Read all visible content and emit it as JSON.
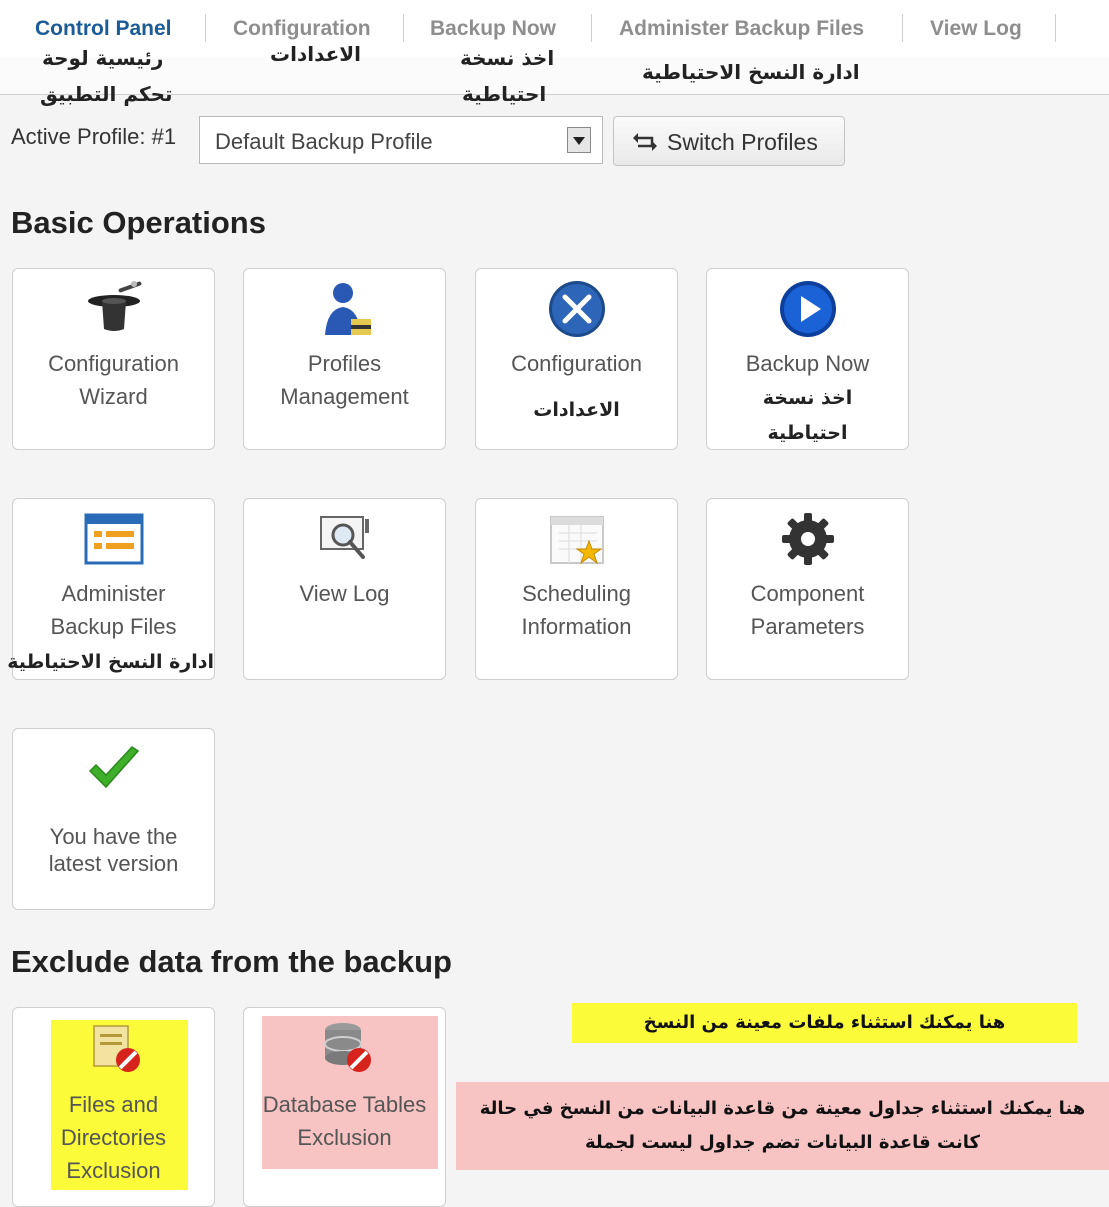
{
  "tabs": [
    {
      "label": "Control Panel",
      "arabic": [
        "رئيسية لوحة",
        "تحكم التطبيق"
      ],
      "active": true
    },
    {
      "label": "Configuration",
      "arabic": [
        "الاعدادات"
      ],
      "active": false
    },
    {
      "label": "Backup Now",
      "arabic": [
        "اخذ نسخة",
        "احتياطية"
      ],
      "active": false
    },
    {
      "label": "Administer Backup Files",
      "arabic": [
        "ادارة النسخ الاحتياطية"
      ],
      "active": false
    },
    {
      "label": "View Log",
      "arabic": [],
      "active": false
    }
  ],
  "profile": {
    "label": "Active Profile: #1",
    "selected": "Default Backup Profile",
    "switch_button": "Switch Profiles"
  },
  "basic_operations": {
    "heading": "Basic Operations",
    "cards": [
      {
        "icon": "magic-hat-icon",
        "lines": [
          "Configuration",
          "Wizard"
        ],
        "arabic": []
      },
      {
        "icon": "profile-user-icon",
        "lines": [
          "Profiles",
          "Management"
        ],
        "arabic": []
      },
      {
        "icon": "tools-icon",
        "lines": [
          "Configuration"
        ],
        "arabic": [
          "الاعدادات"
        ]
      },
      {
        "icon": "play-icon",
        "lines": [
          "Backup Now"
        ],
        "arabic": [
          "اخذ نسخة",
          "احتياطية"
        ]
      },
      {
        "icon": "backup-files-list-icon",
        "lines": [
          "Administer",
          "Backup Files"
        ],
        "arabic": [
          "ادارة النسخ الاحتياطية"
        ]
      },
      {
        "icon": "log-magnifier-icon",
        "lines": [
          "View Log"
        ],
        "arabic": []
      },
      {
        "icon": "calendar-star-icon",
        "lines": [
          "Scheduling",
          "Information"
        ],
        "arabic": []
      },
      {
        "icon": "gear-icon",
        "lines": [
          "Component",
          "Parameters"
        ],
        "arabic": []
      },
      {
        "icon": "checkmark-icon",
        "lines": [
          "You have the",
          "latest version"
        ],
        "arabic": []
      }
    ]
  },
  "exclude": {
    "heading": "Exclude data from the backup",
    "cards": [
      {
        "icon": "folder-exclude-icon",
        "lines": [
          "Files and",
          "Directories",
          "Exclusion"
        ],
        "highlight": "#fbfb3a"
      },
      {
        "icon": "database-exclude-icon",
        "lines": [
          "Database Tables",
          "Exclusion"
        ],
        "highlight": "#f8c3c3"
      }
    ],
    "notes": [
      {
        "text": "هنا يمكنك استثناء ملفات معينة من النسخ",
        "color": "#fbfb3a"
      },
      {
        "lines": [
          "هنا يمكنك استثناء جداول معينة من قاعدة البيانات من النسخ في حالة",
          "كانت قاعدة البيانات تضم جداول ليست لجملة"
        ],
        "color": "#f8c3c3"
      }
    ]
  }
}
